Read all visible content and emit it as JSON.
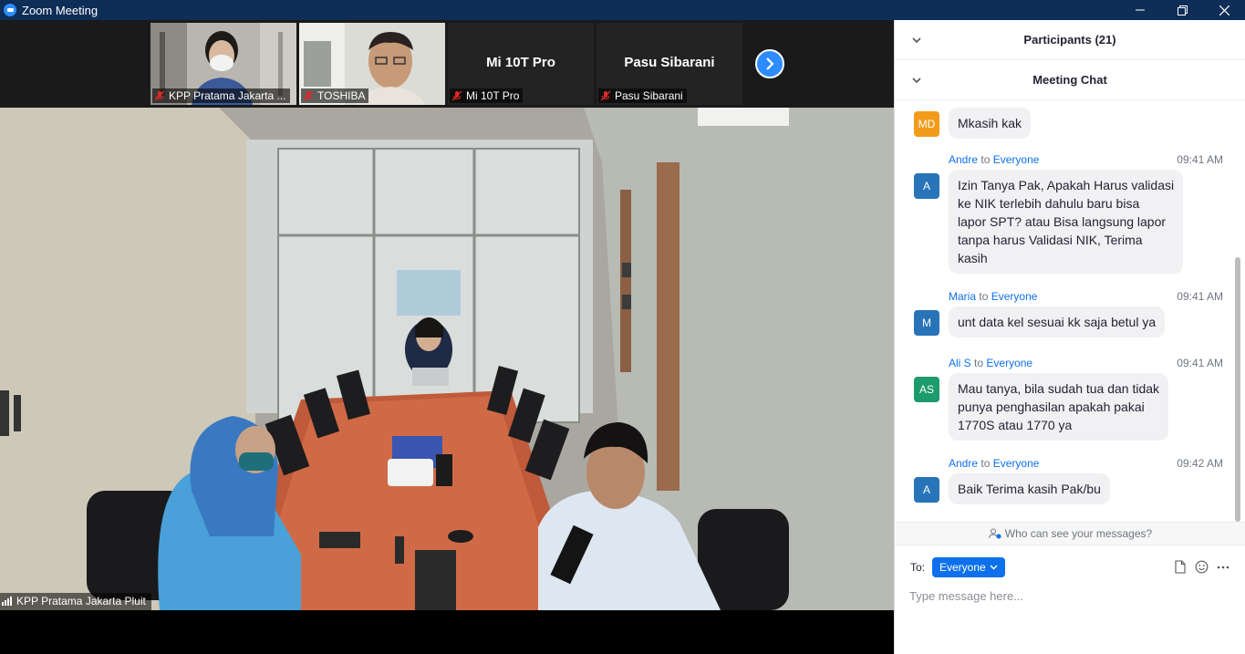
{
  "window": {
    "title": "Zoom Meeting"
  },
  "gallery": {
    "tiles": [
      {
        "name": "KPP Pratama Jakarta ..."
      },
      {
        "name": "TOSHIBA"
      },
      {
        "name": "Mi 10T Pro",
        "display_name": "Mi 10T Pro"
      },
      {
        "name": "Pasu Sibarani",
        "display_name": "Pasu Sibarani"
      }
    ]
  },
  "main_video": {
    "name": "KPP Pratama Jakarta Pluit"
  },
  "panel": {
    "participants_title": "Participants (21)",
    "chat_title": "Meeting Chat",
    "messages": [
      {
        "initials": "MD",
        "avatar_color": "#f29b1b",
        "sender": "",
        "to": "",
        "target": "",
        "time": "",
        "text": "Mkasih kak"
      },
      {
        "initials": "A",
        "avatar_color": "#2774b8",
        "sender": "Andre",
        "to": "to",
        "target": "Everyone",
        "time": "09:41 AM",
        "lines": [
          "Izin Tanya Pak, Apakah Harus validasi",
          "ke NIK terlebih dahulu baru bisa",
          "lapor SPT? atau Bisa langsung lapor",
          "tanpa harus Validasi NIK, Terima",
          "kasih"
        ]
      },
      {
        "initials": "M",
        "avatar_color": "#2774b8",
        "sender": "Maria",
        "to": "to",
        "target": "Everyone",
        "time": "09:41 AM",
        "text": "unt data kel sesuai kk saja betul ya"
      },
      {
        "initials": "AS",
        "avatar_color": "#1c9b6d",
        "sender": "Ali S",
        "to": "to",
        "target": "Everyone",
        "time": "09:41 AM",
        "lines": [
          "Mau tanya, bila sudah tua dan tidak",
          "punya penghasilan apakah pakai",
          "1770S atau 1770 ya"
        ]
      },
      {
        "initials": "A",
        "avatar_color": "#2774b8",
        "sender": "Andre",
        "to": "to",
        "target": "Everyone",
        "time": "09:42 AM",
        "text": "Baik Terima kasih Pak/bu"
      }
    ],
    "who_can_see": "Who can see your messages?",
    "to_label": "To:",
    "to_value": "Everyone",
    "input_placeholder": "Type message here..."
  },
  "colors": {
    "title_bar": "#0e2d57",
    "accent": "#0e71eb",
    "zoom_blue": "#2d8cff"
  }
}
